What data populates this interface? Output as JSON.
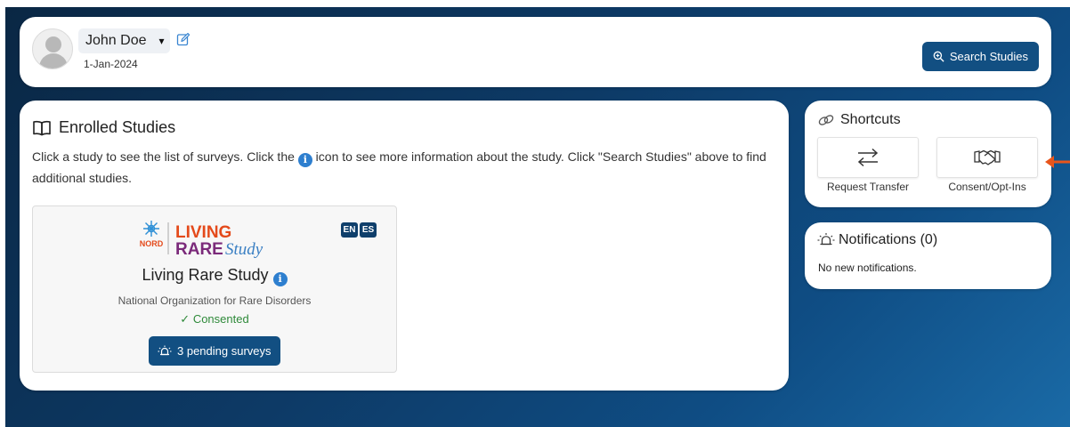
{
  "header": {
    "user_name": "John Doe",
    "date": "1-Jan-2024",
    "search_button": "Search Studies"
  },
  "enrolled": {
    "title": "Enrolled Studies",
    "description_part1": "Click a study to see the list of surveys. Click the",
    "info_glyph": "i",
    "description_part2": "icon to see more information about the study. Click \"Search Studies\" above to find additional studies.",
    "study": {
      "logo_org": "NORD",
      "logo_living": "LIVING",
      "logo_rare": "RARE",
      "logo_study": "Study",
      "languages": [
        "EN",
        "ES"
      ],
      "name": "Living Rare Study",
      "organization": "National Organization for Rare Disorders",
      "status": "Consented",
      "status_check": "✓",
      "pending_button": "3 pending surveys"
    }
  },
  "shortcuts": {
    "title": "Shortcuts",
    "items": [
      {
        "label": "Request Transfer",
        "icon": "transfer-arrows-icon"
      },
      {
        "label": "Consent/Opt-Ins",
        "icon": "handshake-icon"
      }
    ]
  },
  "notifications": {
    "title": "Notifications (0)",
    "empty_text": "No new notifications."
  },
  "colors": {
    "primary": "#124f82",
    "consented": "#2f8a3a",
    "info": "#2e7fcf",
    "indicator_arrow": "#e8551b",
    "background_dark": "#0a2744"
  }
}
